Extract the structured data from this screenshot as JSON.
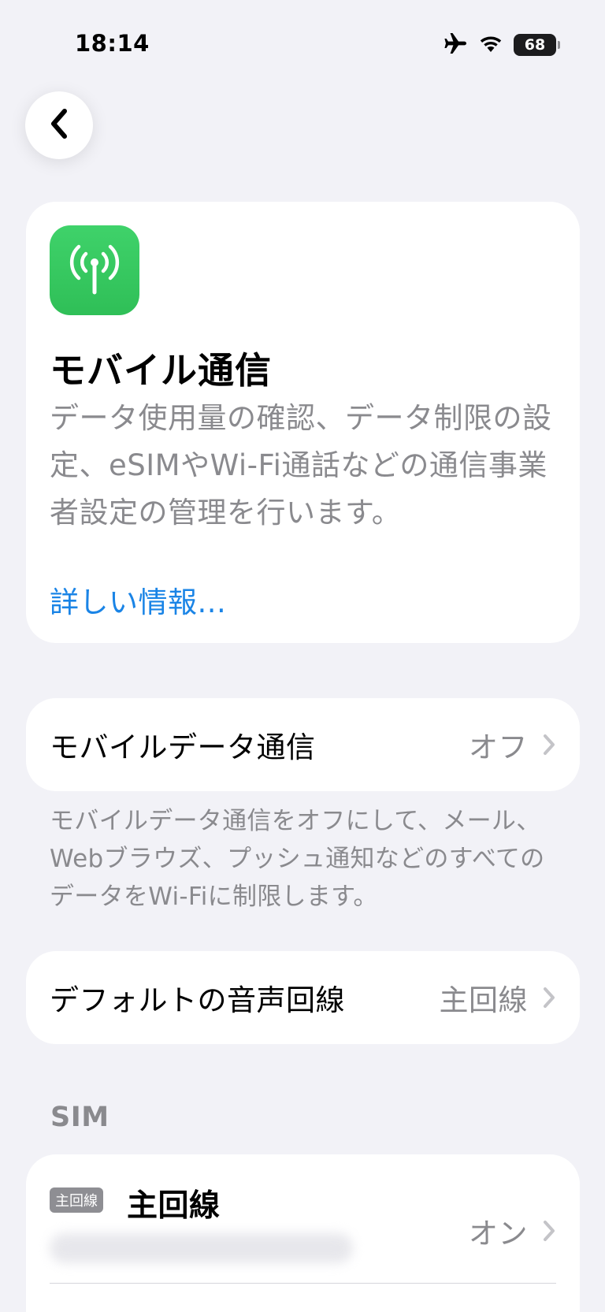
{
  "status_bar": {
    "time": "18:14",
    "battery_level": "68",
    "icons": [
      "airplane-icon",
      "wifi-icon",
      "battery-icon"
    ]
  },
  "nav": {
    "back_icon": "chevron-left-icon"
  },
  "hero": {
    "icon": "antenna-icon",
    "icon_color": "#34c759",
    "title": "モバイル通信",
    "description": "データ使用量の確認、データ制限の設定、eSIMやWi-Fi通話などの通信事業者設定の管理を行います。",
    "learn_more": "詳しい情報..."
  },
  "mobile_data": {
    "label": "モバイルデータ通信",
    "value": "オフ",
    "footnote": "モバイルデータ通信をオフにして、メール、Webブラウズ、プッシュ通知などのすべてのデータをWi-Fiに制限します。"
  },
  "default_voice": {
    "label": "デフォルトの音声回線",
    "value": "主回線"
  },
  "sim_section": {
    "header": "SIM",
    "items": [
      {
        "badge": "主回線",
        "name": "主回線",
        "status": "オン"
      }
    ]
  },
  "colors": {
    "background": "#f2f2f7",
    "card": "#ffffff",
    "secondary_text": "#8a8a8e",
    "link": "#1a84e6"
  }
}
